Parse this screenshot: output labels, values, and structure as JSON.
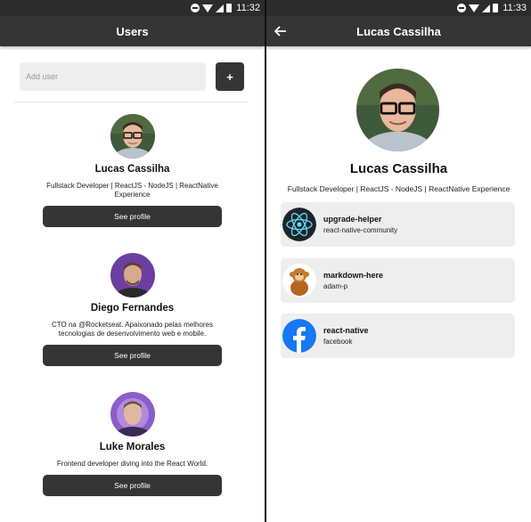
{
  "left": {
    "status": {
      "time": "11:32"
    },
    "header": {
      "title": "Users"
    },
    "form": {
      "placeholder": "Add user",
      "add_label": "+"
    },
    "users": [
      {
        "name": "Lucas Cassilha",
        "bio": "Fullstack Developer | ReactJS - NodeJS | ReactNative Experience",
        "button": "See profile"
      },
      {
        "name": "Diego Fernandes",
        "bio": "CTO na @Rocketseat. Apaixonado pelas melhores tecnologias de desenvolvimento web e mobile.",
        "button": "See profile"
      },
      {
        "name": "Luke Morales",
        "bio": "Frontend developer diving into the React World.",
        "button": "See profile"
      }
    ]
  },
  "right": {
    "status": {
      "time": "11:33"
    },
    "header": {
      "title": "Lucas Cassilha",
      "back_icon": "arrow-left-icon"
    },
    "profile": {
      "name": "Lucas Cassilha",
      "bio": "Fullstack Developer | ReactJS - NodeJS | ReactNative Experience"
    },
    "repos": [
      {
        "name": "upgrade-helper",
        "owner": "react-native-community",
        "icon": "react-logo"
      },
      {
        "name": "markdown-here",
        "owner": "adam-p",
        "icon": "monkey-avatar"
      },
      {
        "name": "react-native",
        "owner": "facebook",
        "icon": "facebook-logo"
      }
    ]
  },
  "colors": {
    "appbar": "#353535",
    "statusbar": "#2c2c2c",
    "card": "#eeeeee",
    "button": "#353535"
  }
}
